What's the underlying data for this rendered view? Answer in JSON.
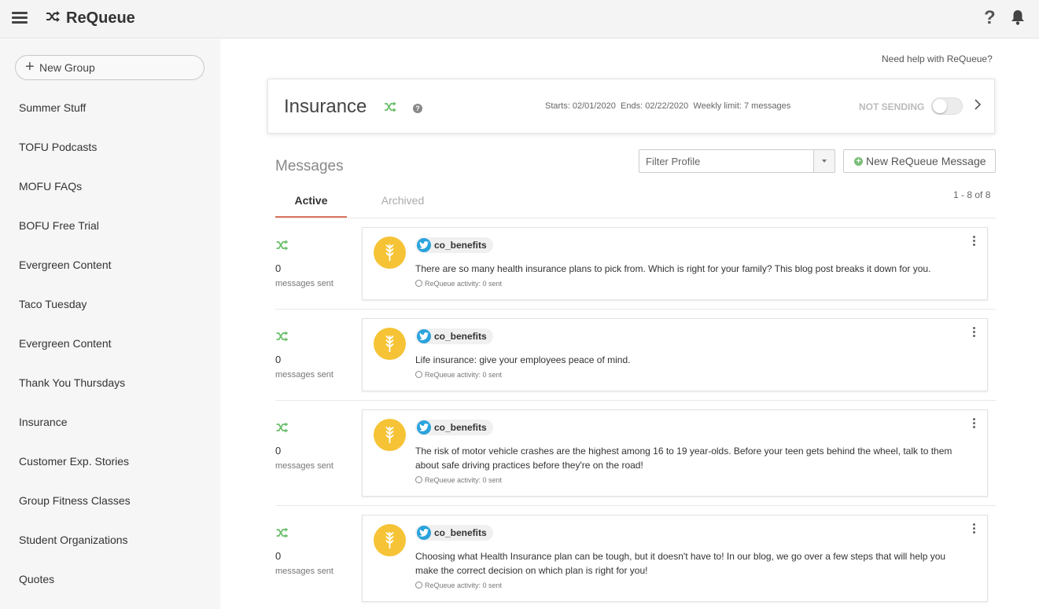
{
  "app": {
    "title": "ReQueue",
    "help_glyph": "?"
  },
  "sidebar": {
    "new_group_label": "New Group",
    "items": [
      "Summer Stuff",
      "TOFU Podcasts",
      "MOFU FAQs",
      "BOFU Free Trial",
      "Evergreen Content",
      "Taco Tuesday",
      "Evergreen Content",
      "Thank You Thursdays",
      "Insurance",
      "Customer Exp. Stories",
      "Group Fitness Classes",
      "Student Organizations",
      "Quotes"
    ]
  },
  "header": {
    "need_help": "Need help with ReQueue?"
  },
  "group": {
    "title": "Insurance",
    "starts": "Starts: 02/01/2020",
    "ends": "Ends: 02/22/2020",
    "weekly_limit": "Weekly limit: 7 messages",
    "status": "NOT SENDING",
    "sending": false
  },
  "messages": {
    "title": "Messages",
    "filter_placeholder": "Filter Profile",
    "new_message_label": "New ReQueue Message",
    "tabs": {
      "active": "Active",
      "archived": "Archived"
    },
    "pagination": "1 - 8 of 8",
    "items": [
      {
        "count": "0",
        "sent_label": "messages sent",
        "profile": "co_benefits",
        "text": "There are so many health insurance plans to pick from. Which is right for your family? This blog post breaks it down for you.",
        "activity": "ReQueue activity: 0 sent"
      },
      {
        "count": "0",
        "sent_label": "messages sent",
        "profile": "co_benefits",
        "text": "Life insurance: give your employees peace of mind.",
        "activity": "ReQueue activity: 0 sent"
      },
      {
        "count": "0",
        "sent_label": "messages sent",
        "profile": "co_benefits",
        "text": "The risk of motor vehicle crashes are the highest among 16 to 19 year-olds. Before your teen gets behind the wheel, talk to them about safe driving practices before they're on the road!",
        "activity": "ReQueue activity: 0 sent"
      },
      {
        "count": "0",
        "sent_label": "messages sent",
        "profile": "co_benefits",
        "text": "Choosing what Health Insurance plan can be tough, but it doesn't have to! In our blog, we go over a few steps that will help you make the correct decision on which plan is right for you!",
        "activity": "ReQueue activity: 0 sent"
      }
    ]
  },
  "colors": {
    "accent": "#d9735d",
    "shuffle_green": "#6cbf6c",
    "avatar_yellow": "#f5c335",
    "twitter_blue": "#2aa3dd"
  }
}
